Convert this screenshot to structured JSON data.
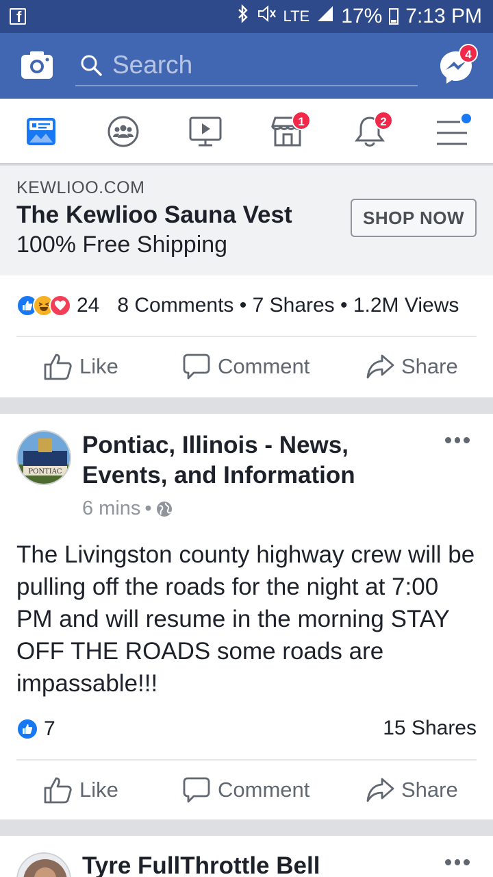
{
  "status_bar": {
    "app_icon": "facebook-icon",
    "network": "LTE",
    "battery": "17%",
    "time": "7:13 PM"
  },
  "app_bar": {
    "search_placeholder": "Search",
    "messenger_badge": "4"
  },
  "nav": {
    "items": [
      {
        "icon": "news-feed-icon",
        "badge": ""
      },
      {
        "icon": "groups-icon",
        "badge": ""
      },
      {
        "icon": "watch-icon",
        "badge": ""
      },
      {
        "icon": "marketplace-icon",
        "badge": "1"
      },
      {
        "icon": "notifications-icon",
        "badge": "2"
      },
      {
        "icon": "menu-icon",
        "badge": ""
      }
    ]
  },
  "ad": {
    "domain": "KEWLIOO.COM",
    "title": "The Kewlioo Sauna Vest",
    "subtitle": "100% Free Shipping",
    "cta": "SHOP NOW",
    "reaction_count": "24",
    "stats": "8 Comments • 7 Shares • 1.2M Views"
  },
  "actions": {
    "like": "Like",
    "comment": "Comment",
    "share": "Share"
  },
  "post1": {
    "page_name_line1": "Pontiac, Illinois - News,",
    "page_name_line2": "Events, and Information",
    "avatar_label": "PONTIAC",
    "time": "6 mins",
    "text": "The Livingston county highway crew will be pulling off the roads for the night at 7:00 PM and will resume in the morning STAY OFF THE ROADS some roads are impassable!!!",
    "likes": "7",
    "shares": "15 Shares"
  },
  "post2": {
    "author": "Tyre FullThrottle Bell"
  },
  "colors": {
    "brand": "#4267b2",
    "status_bar": "#2f4a8a",
    "badge": "#f02849"
  }
}
